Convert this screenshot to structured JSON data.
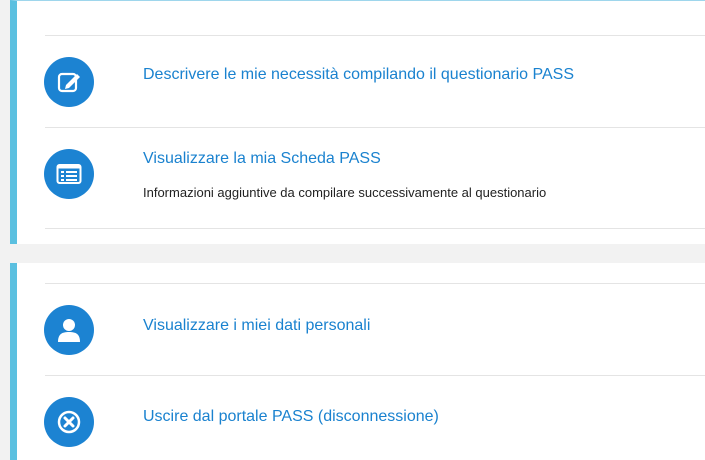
{
  "colors": {
    "accent_blue": "#1c83d2",
    "link_text": "#1a82cf",
    "left_border": "#5bc0e0",
    "background": "#f2f2f2"
  },
  "menu_top": {
    "items": [
      {
        "icon": "edit-icon",
        "label": "Descrivere le mie necessità compilando il questionario PASS"
      },
      {
        "icon": "id-card-icon",
        "label": "Visualizzare la mia Scheda PASS",
        "description": "Informazioni aggiuntive da compilare successivamente al questionario"
      }
    ]
  },
  "menu_bottom": {
    "items": [
      {
        "icon": "user-icon",
        "label": "Visualizzare i miei dati personali"
      },
      {
        "icon": "logout-icon",
        "label": "Uscire dal portale PASS (disconnessione)"
      }
    ]
  }
}
